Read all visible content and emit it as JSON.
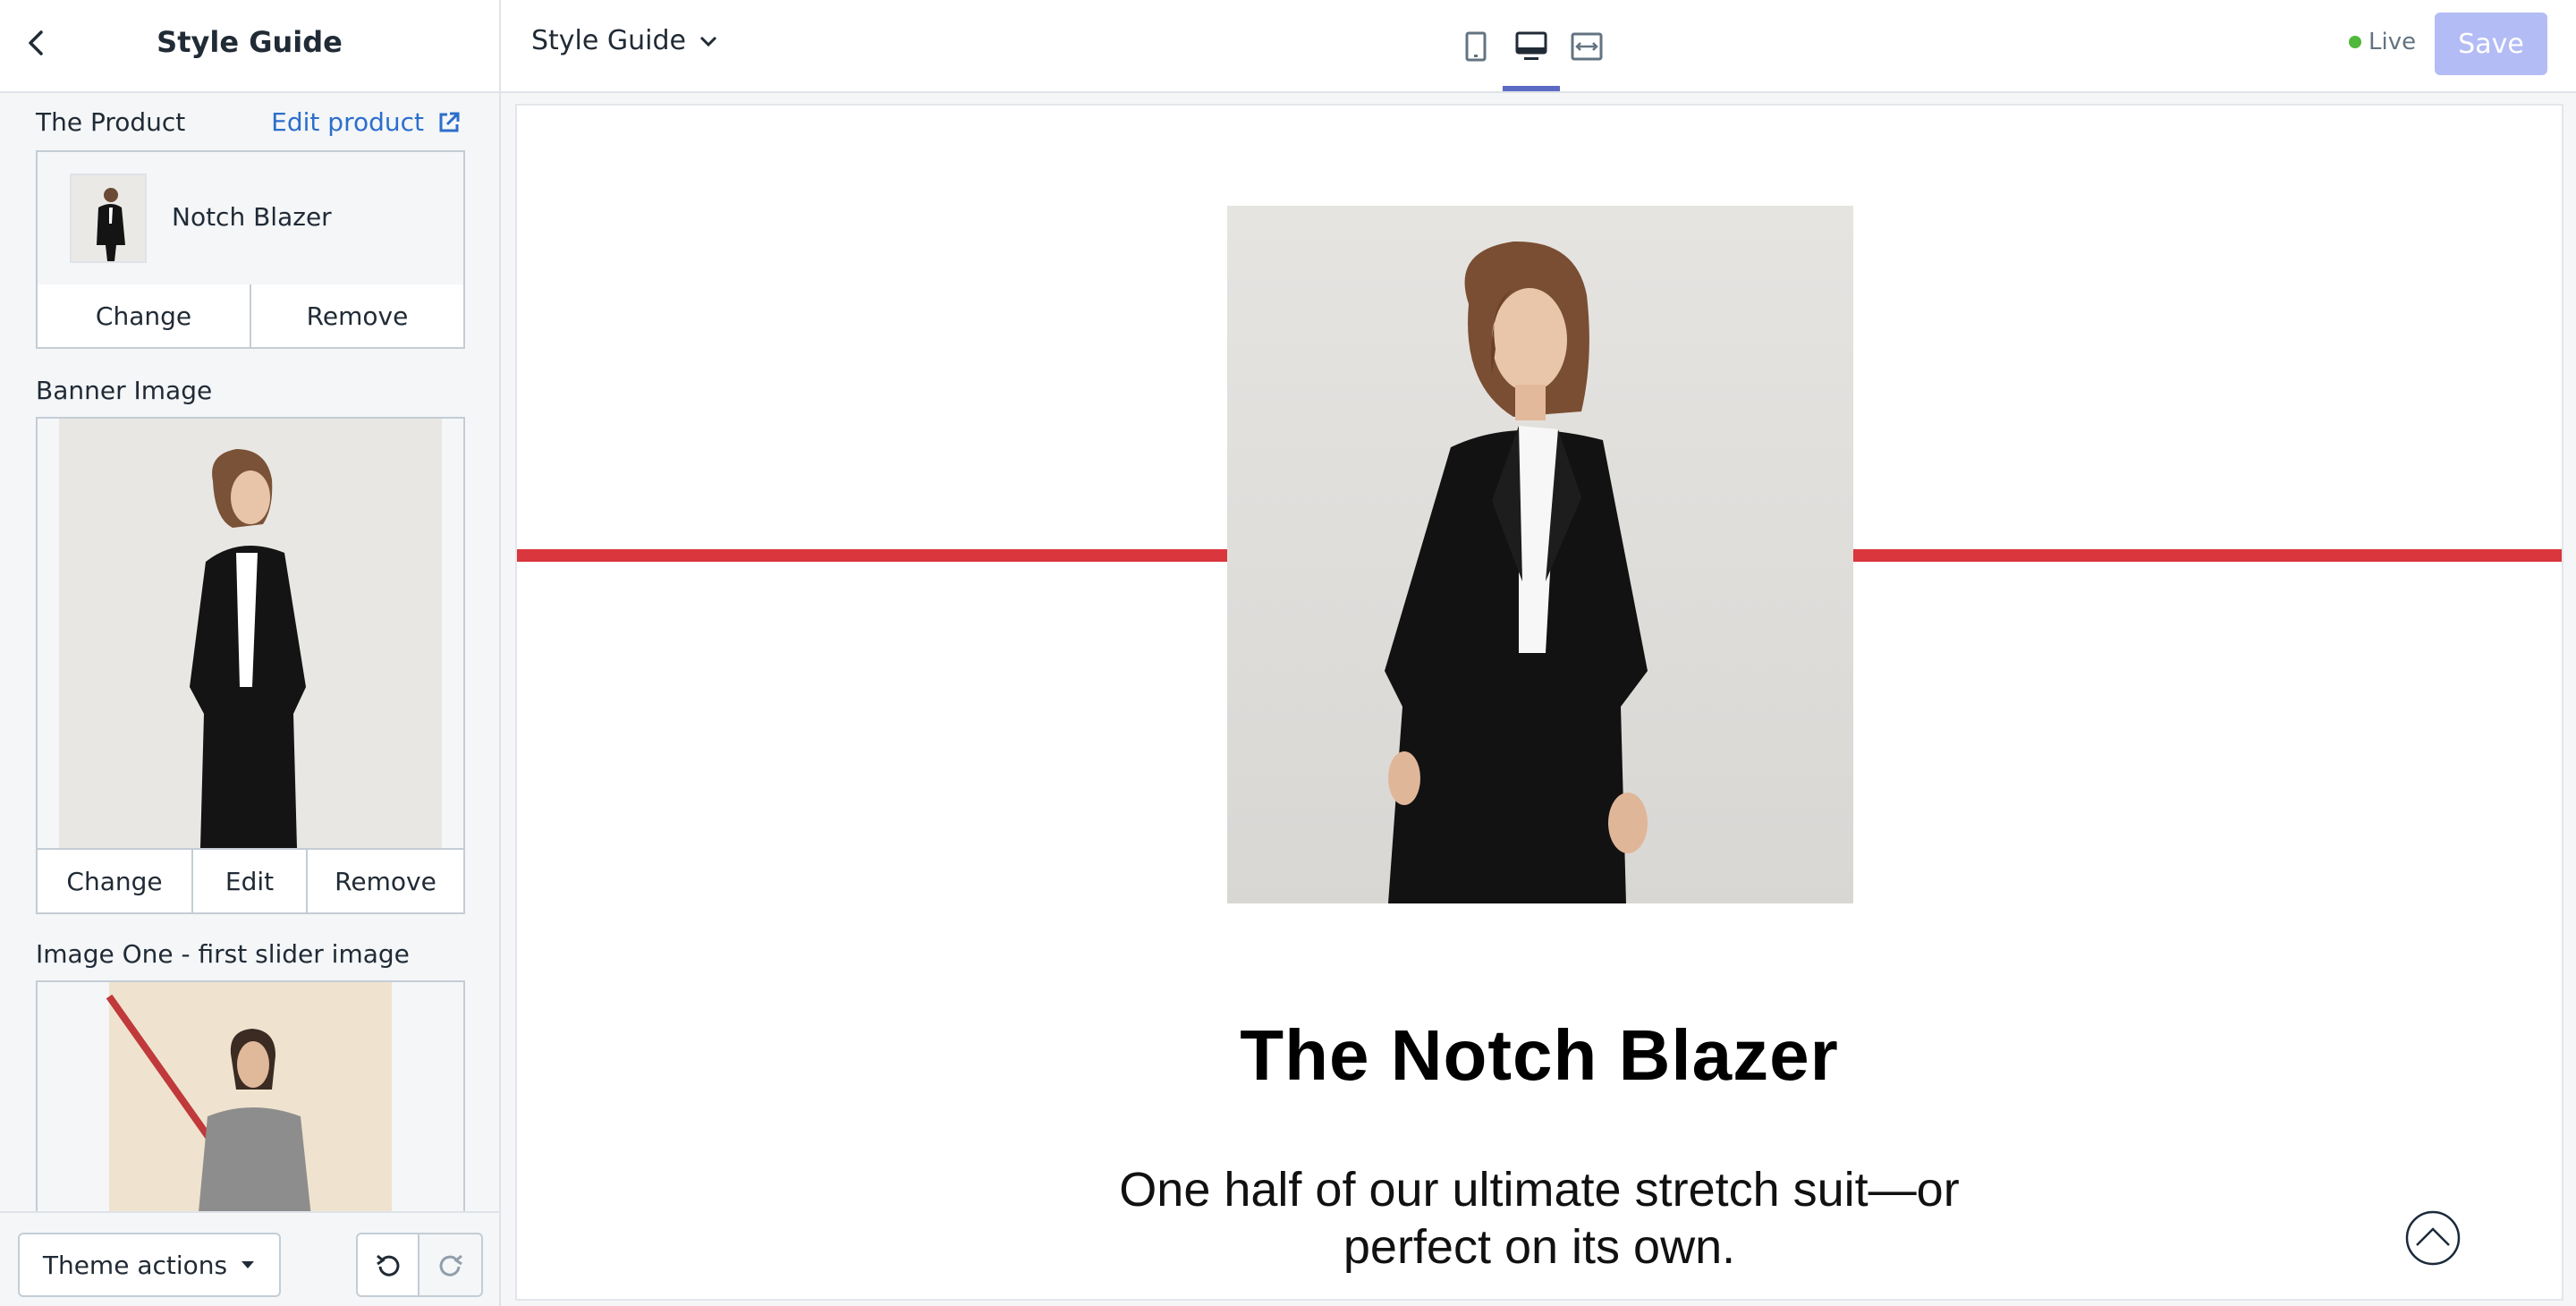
{
  "sidebar": {
    "title": "Style Guide",
    "product_section": {
      "label": "The Product",
      "edit_link": "Edit product",
      "product_name": "Notch Blazer",
      "change_label": "Change",
      "remove_label": "Remove"
    },
    "banner_section": {
      "label": "Banner Image",
      "change_label": "Change",
      "edit_label": "Edit",
      "remove_label": "Remove"
    },
    "slider_section": {
      "label": "Image One - first slider image"
    },
    "footer": {
      "theme_actions_label": "Theme actions"
    }
  },
  "topbar": {
    "page_selector": "Style Guide",
    "devices": [
      "mobile-icon",
      "desktop-icon",
      "full-width-icon"
    ],
    "active_device": "desktop-icon",
    "status_label": "Live",
    "save_label": "Save"
  },
  "preview": {
    "product_title": "The Notch Blazer",
    "product_description": "One half of our ultimate stretch suit—or perfect on its own."
  },
  "colors": {
    "accent": "#5c6ac4",
    "link": "#2c6ecb",
    "live_dot": "#50b83c",
    "save_disabled": "#b3bcf5",
    "divider_red": "#d9363e"
  }
}
